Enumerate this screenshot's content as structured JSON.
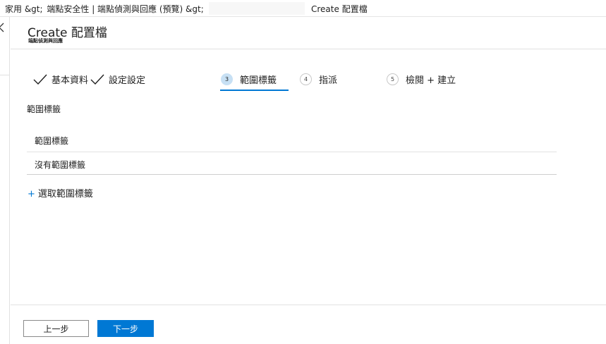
{
  "breadcrumb": {
    "items": [
      "家用 &gt;",
      "端點安全性 | 端點偵測與回應 (預覽) &gt;"
    ],
    "current": "Create 配置檔"
  },
  "blade": {
    "title": "Create 配置檔",
    "subtitle": "端點偵測與回應"
  },
  "wizard": {
    "steps": [
      {
        "label": "基本資料",
        "state": "completed",
        "icon": "check-icon"
      },
      {
        "label": "設定設定",
        "state": "completed",
        "icon": "check-icon"
      },
      {
        "number": "3",
        "label": "範圍標籤",
        "state": "active"
      },
      {
        "number": "4",
        "label": "指派",
        "state": "pending"
      },
      {
        "number": "5",
        "label": "檢閱 + 建立",
        "state": "pending"
      }
    ]
  },
  "scope_tags": {
    "section_label": "範圍標籤",
    "column_header": "範圍標籤",
    "rows": [
      "沒有範圍標籤"
    ],
    "select_link": "選取範圍標籤",
    "select_icon": "plus-icon"
  },
  "footer": {
    "prev_label": "上一步",
    "next_label": "下一步"
  },
  "colors": {
    "accent": "#0078d4",
    "active_step_bg": "#c7e0f4"
  }
}
